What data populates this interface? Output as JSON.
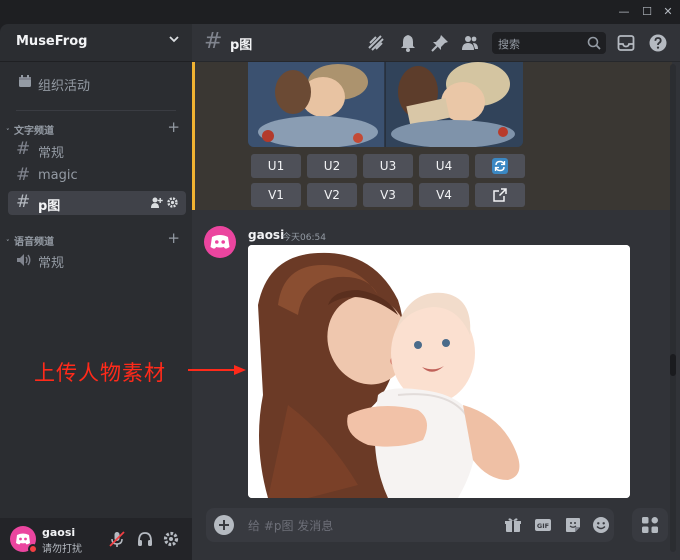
{
  "window": {
    "minimize": "—",
    "maximize": "☐",
    "close": "✕"
  },
  "sidebar": {
    "server_name": "MuseFrog",
    "events_label": "组织活动",
    "text_category": "文字频道",
    "text_channels": [
      {
        "name": "常规"
      },
      {
        "name": "magic"
      },
      {
        "name": "p图",
        "active": true
      }
    ],
    "voice_category": "语音频道",
    "voice_channels": [
      {
        "name": "常规"
      }
    ]
  },
  "user_panel": {
    "username": "gaosi",
    "status_text": "请勿打扰"
  },
  "topbar": {
    "channel_name": "p图",
    "search_placeholder": "搜索"
  },
  "upscale_buttons": {
    "row1": [
      "U1",
      "U2",
      "U3",
      "U4"
    ],
    "row2": [
      "V1",
      "V2",
      "V3",
      "V4"
    ]
  },
  "message": {
    "author": "gaosi",
    "timestamp": "今天06:54"
  },
  "annotation": {
    "text": "上传人物素材"
  },
  "composer": {
    "placeholder": "给 #p图 发消息",
    "gif_label": "GIF"
  },
  "colors": {
    "accent_pink": "#eb459f",
    "highlight_border": "#f0b232",
    "annotation_red": "#ff2a1a",
    "dnd_red": "#f23f43"
  }
}
